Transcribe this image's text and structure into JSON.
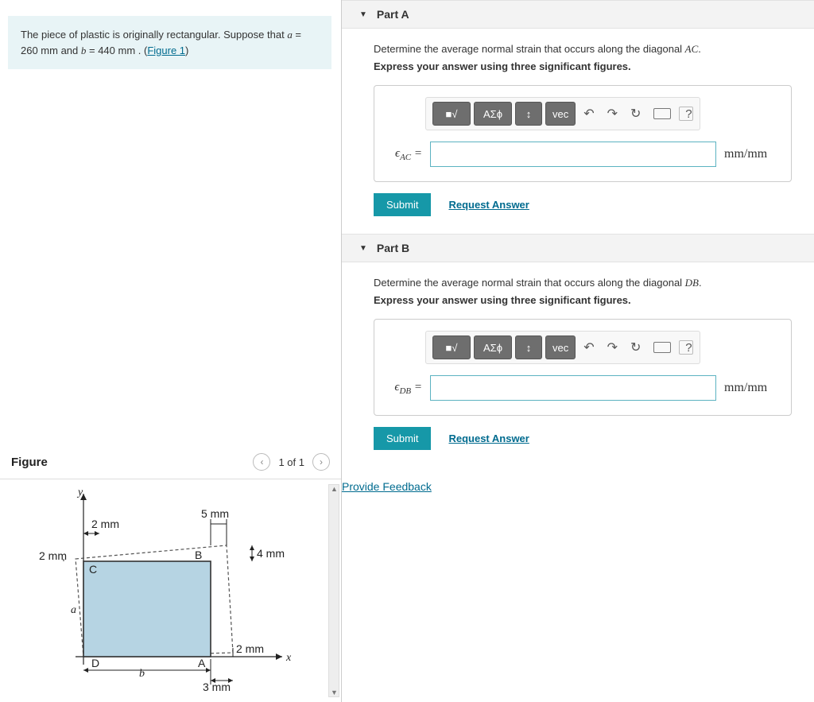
{
  "problem": {
    "prefix": "The piece of plastic is originally rectangular. Suppose that ",
    "varA": "a",
    "valA": " = 260 mm",
    "andWord": " and ",
    "varB": "b",
    "valB": " = 440 mm",
    "suffix1": " . (",
    "figLink": "Figure 1",
    "suffix2": ")"
  },
  "figure": {
    "label": "Figure",
    "count": "1 of 1",
    "dims": {
      "top5": "5 mm",
      "top2": "2 mm",
      "left2": "2 mm",
      "right4": "4 mm",
      "bottom2": "2 mm",
      "bottom3": "3 mm"
    },
    "labels": {
      "A": "A",
      "B": "B",
      "C": "C",
      "D": "D",
      "a": "a",
      "b": "b",
      "x": "x",
      "y": "y"
    }
  },
  "partA": {
    "title": "Part A",
    "prompt_pre": "Determine the average normal strain that occurs along the diagonal ",
    "diag": "AC",
    "prompt_post": ".",
    "instr": "Express your answer using three significant figures.",
    "varPre": "ϵ",
    "varSub": "AC",
    "eq": " =",
    "unit": "mm/mm",
    "submit": "Submit",
    "reqAnswer": "Request Answer"
  },
  "partB": {
    "title": "Part B",
    "prompt_pre": "Determine the average normal strain that occurs along the diagonal ",
    "diag": "DB",
    "prompt_post": ".",
    "instr": "Express your answer using three significant figures.",
    "varPre": "ϵ",
    "varSub": "DB",
    "eq": " =",
    "unit": "mm/mm",
    "submit": "Submit",
    "reqAnswer": "Request Answer"
  },
  "toolbar": {
    "templates": "■√",
    "greek": "ΑΣϕ",
    "scripts": "↕",
    "vec": "vec",
    "undo": "↶",
    "redo": "↷",
    "reset": "↻",
    "help": "?"
  },
  "feedback": "Provide Feedback"
}
